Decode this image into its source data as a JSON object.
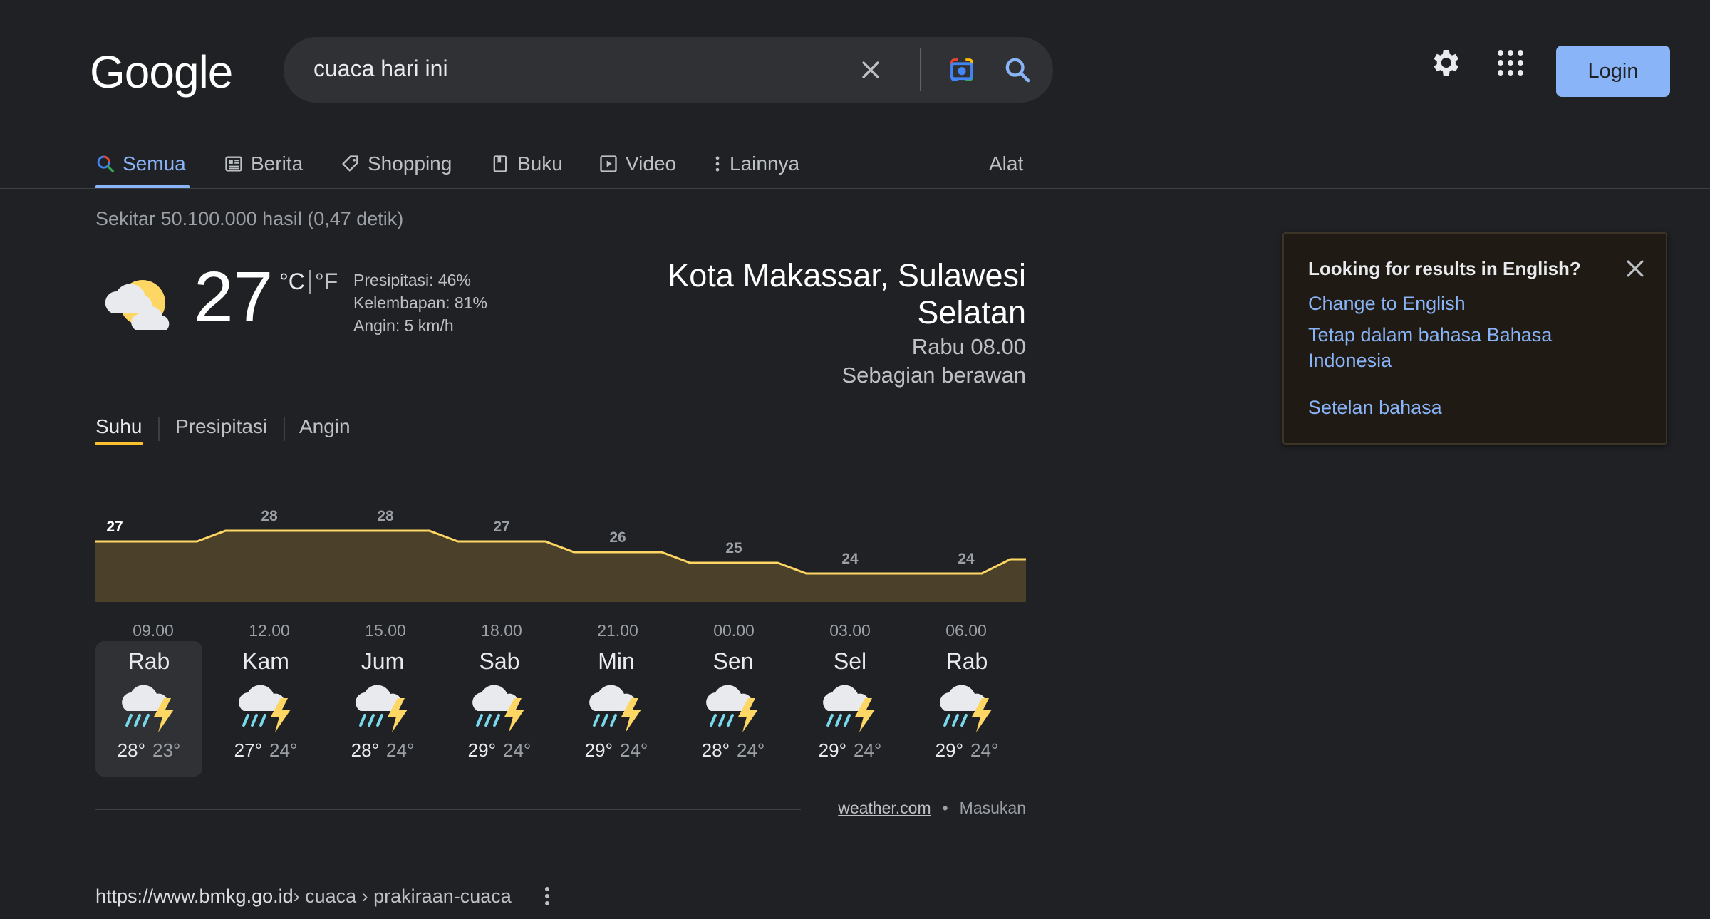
{
  "header": {
    "logo": "Google",
    "search_query": "cuaca hari ini",
    "login_label": "Login"
  },
  "tabs": {
    "items": [
      {
        "label": "Semua",
        "icon": "search-icon",
        "active": true
      },
      {
        "label": "Berita",
        "icon": "news-icon"
      },
      {
        "label": "Shopping",
        "icon": "tag-icon"
      },
      {
        "label": "Buku",
        "icon": "book-icon"
      },
      {
        "label": "Video",
        "icon": "play-icon"
      },
      {
        "label": "Lainnya",
        "icon": "more-vert-icon"
      }
    ],
    "tools_label": "Alat"
  },
  "result_stats": "Sekitar 50.100.000 hasil (0,47 detik)",
  "weather": {
    "temperature": "27",
    "unit_c": "°C",
    "unit_f": "°F",
    "precipitation": "Presipitasi: 46%",
    "humidity": "Kelembapan: 81%",
    "wind": "Angin: 5 km/h",
    "location_line1": "Kota Makassar, Sulawesi",
    "location_line2": "Selatan",
    "time": "Rabu 08.00",
    "condition": "Sebagian berawan",
    "subtabs": [
      "Suhu",
      "Presipitasi",
      "Angin"
    ],
    "days": [
      {
        "name": "Rab",
        "hi": "28°",
        "lo": "23°",
        "icon": "thunderstorm-icon",
        "selected": true
      },
      {
        "name": "Kam",
        "hi": "27°",
        "lo": "24°",
        "icon": "thunderstorm-icon"
      },
      {
        "name": "Jum",
        "hi": "28°",
        "lo": "24°",
        "icon": "thunderstorm-icon"
      },
      {
        "name": "Sab",
        "hi": "29°",
        "lo": "24°",
        "icon": "thunderstorm-icon"
      },
      {
        "name": "Min",
        "hi": "29°",
        "lo": "24°",
        "icon": "thunderstorm-icon"
      },
      {
        "name": "Sen",
        "hi": "28°",
        "lo": "24°",
        "icon": "thunderstorm-icon"
      },
      {
        "name": "Sel",
        "hi": "29°",
        "lo": "24°",
        "icon": "thunderstorm-icon"
      },
      {
        "name": "Rab",
        "hi": "29°",
        "lo": "24°",
        "icon": "thunderstorm-icon"
      }
    ],
    "source_link": "weather.com",
    "bullet": "•",
    "feedback": "Masukan"
  },
  "chart_data": {
    "type": "area",
    "x": [
      "09.00",
      "12.00",
      "15.00",
      "18.00",
      "21.00",
      "00.00",
      "03.00",
      "06.00"
    ],
    "values": [
      27,
      28,
      28,
      27,
      26,
      25,
      24,
      24
    ],
    "labels": [
      "27",
      "28",
      "28",
      "27",
      "26",
      "25",
      "24",
      "24"
    ],
    "unit": "°C",
    "colors": {
      "line": "#fdd663",
      "fill": "#4b4029"
    }
  },
  "citation": {
    "domain": "https://www.bmkg.go.id",
    "path": " › cuaca › prakiraan-cuaca"
  },
  "lang_popup": {
    "title": "Looking for results in English?",
    "change_link": "Change to English",
    "stay_link_line1": "Tetap dalam bahasa Bahasa",
    "stay_link_line2": "Indonesia",
    "settings_link": "Setelan bahasa"
  },
  "colors": {
    "background": "#202124",
    "accent": "#8ab4f8",
    "chart_line": "#fdd663"
  }
}
